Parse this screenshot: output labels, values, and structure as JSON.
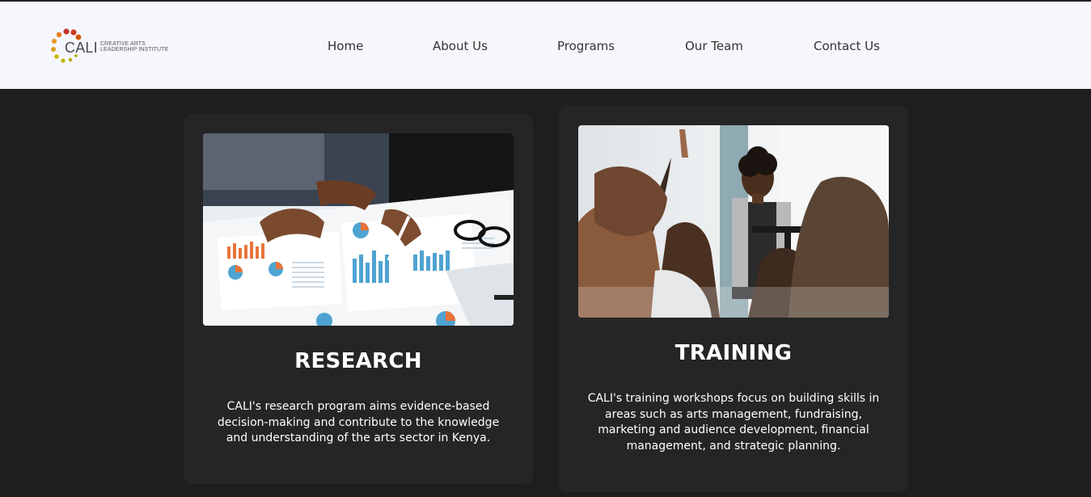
{
  "brand": {
    "name": "CALI",
    "subtitle_line1": "CREATIVE ARTS",
    "subtitle_line2": "LEADERSHIP INSTITUTE",
    "dot_colors": [
      "#c0392b",
      "#d35400",
      "#e67e22",
      "#d4a017",
      "#c9b800",
      "#b5a800"
    ]
  },
  "nav": {
    "items": [
      {
        "label": "Home"
      },
      {
        "label": "About Us"
      },
      {
        "label": "Programs"
      },
      {
        "label": "Our Team"
      },
      {
        "label": "Contact Us"
      }
    ]
  },
  "cards": [
    {
      "title": "RESEARCH",
      "text": "CALI's research program aims evidence-based decision-making and contribute to the knowledge and understanding of the arts sector in Kenya."
    },
    {
      "title": "TRAINING",
      "text": "CALI's training workshops focus on building skills in areas such as arts management, fundraising, marketing and audience development, financial management, and strategic planning."
    }
  ],
  "colors": {
    "header_bg": "#f6f6fd",
    "page_bg": "#1e1e1e",
    "card_bg": "#252525",
    "text_light": "#ffffff",
    "nav_text": "#333333"
  }
}
